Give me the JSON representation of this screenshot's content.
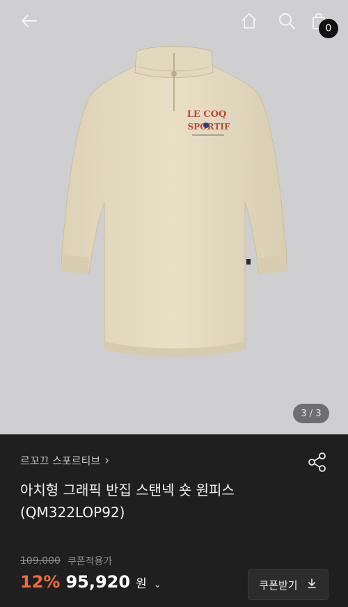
{
  "header": {
    "back_icon": "arrow-left-icon",
    "home_icon": "home-icon",
    "search_icon": "search-icon",
    "cart_icon": "shopping-bag-icon",
    "cart_count": "0"
  },
  "gallery": {
    "indicator": "3 / 3",
    "print_line1": "LE COQ",
    "print_line2": "SPORTIF"
  },
  "product": {
    "brand": "르꼬끄 스포르티브",
    "brand_chevron": "›",
    "title_line1": "아치형 그래픽 반집 스탠넥 숏 원피스",
    "title_line2": "(QM322LOP92)",
    "share_icon": "share-icon"
  },
  "price": {
    "original": "109,000",
    "coupon_label": "쿠폰적용가",
    "discount": "12%",
    "final": "95,920",
    "currency": "원",
    "dropdown": "⌄"
  },
  "coupon_button": {
    "label": "쿠폰받기",
    "icon": "download-icon"
  },
  "colors": {
    "discount": "#f06b3c",
    "background": "#1f1f1f",
    "hero_bg": "#cfcfd1",
    "garment": "#e6dcc2"
  }
}
